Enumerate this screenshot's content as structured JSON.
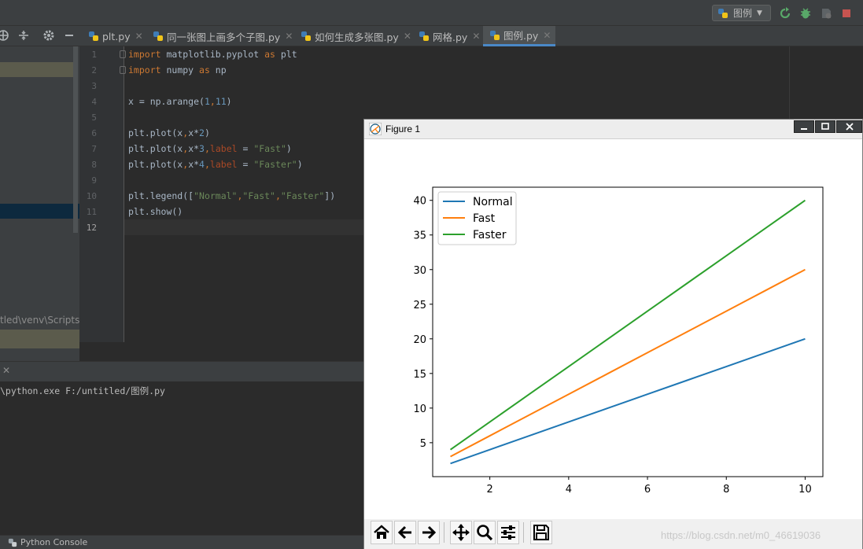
{
  "toolbar": {
    "run_config": "图例"
  },
  "tabs": [
    {
      "label": "plt.py"
    },
    {
      "label": "同一张图上画多个子图.py"
    },
    {
      "label": "如何生成多张图.py"
    },
    {
      "label": "网格.py"
    },
    {
      "label": "图例.py"
    }
  ],
  "project": {
    "path_fragment": "tled\\venv\\Scripts\\"
  },
  "editor": {
    "line_numbers": [
      "1",
      "2",
      "3",
      "4",
      "5",
      "6",
      "7",
      "8",
      "9",
      "10",
      "11",
      "12"
    ]
  },
  "run": {
    "command": "\\python.exe F:/untitled/图例.py"
  },
  "status": {
    "python_console": "Python Console"
  },
  "figure": {
    "title": "Figure 1",
    "watermark": "https://blog.csdn.net/m0_46619036"
  },
  "chart_data": {
    "type": "line",
    "x": [
      1,
      2,
      3,
      4,
      5,
      6,
      7,
      8,
      9,
      10
    ],
    "series": [
      {
        "name": "Normal",
        "values": [
          2,
          4,
          6,
          8,
          10,
          12,
          14,
          16,
          18,
          20
        ],
        "color": "#1f77b4"
      },
      {
        "name": "Fast",
        "values": [
          3,
          6,
          9,
          12,
          15,
          18,
          21,
          24,
          27,
          30
        ],
        "color": "#ff7f0e"
      },
      {
        "name": "Faster",
        "values": [
          4,
          8,
          12,
          16,
          20,
          24,
          28,
          32,
          36,
          40
        ],
        "color": "#2ca02c"
      }
    ],
    "xticks": [
      2,
      4,
      6,
      8,
      10
    ],
    "yticks": [
      5,
      10,
      15,
      20,
      25,
      30,
      35,
      40
    ],
    "xlim": [
      0.55,
      10.45
    ],
    "ylim": [
      0.1,
      41.9
    ],
    "legend": "upper-left",
    "grid": false
  }
}
